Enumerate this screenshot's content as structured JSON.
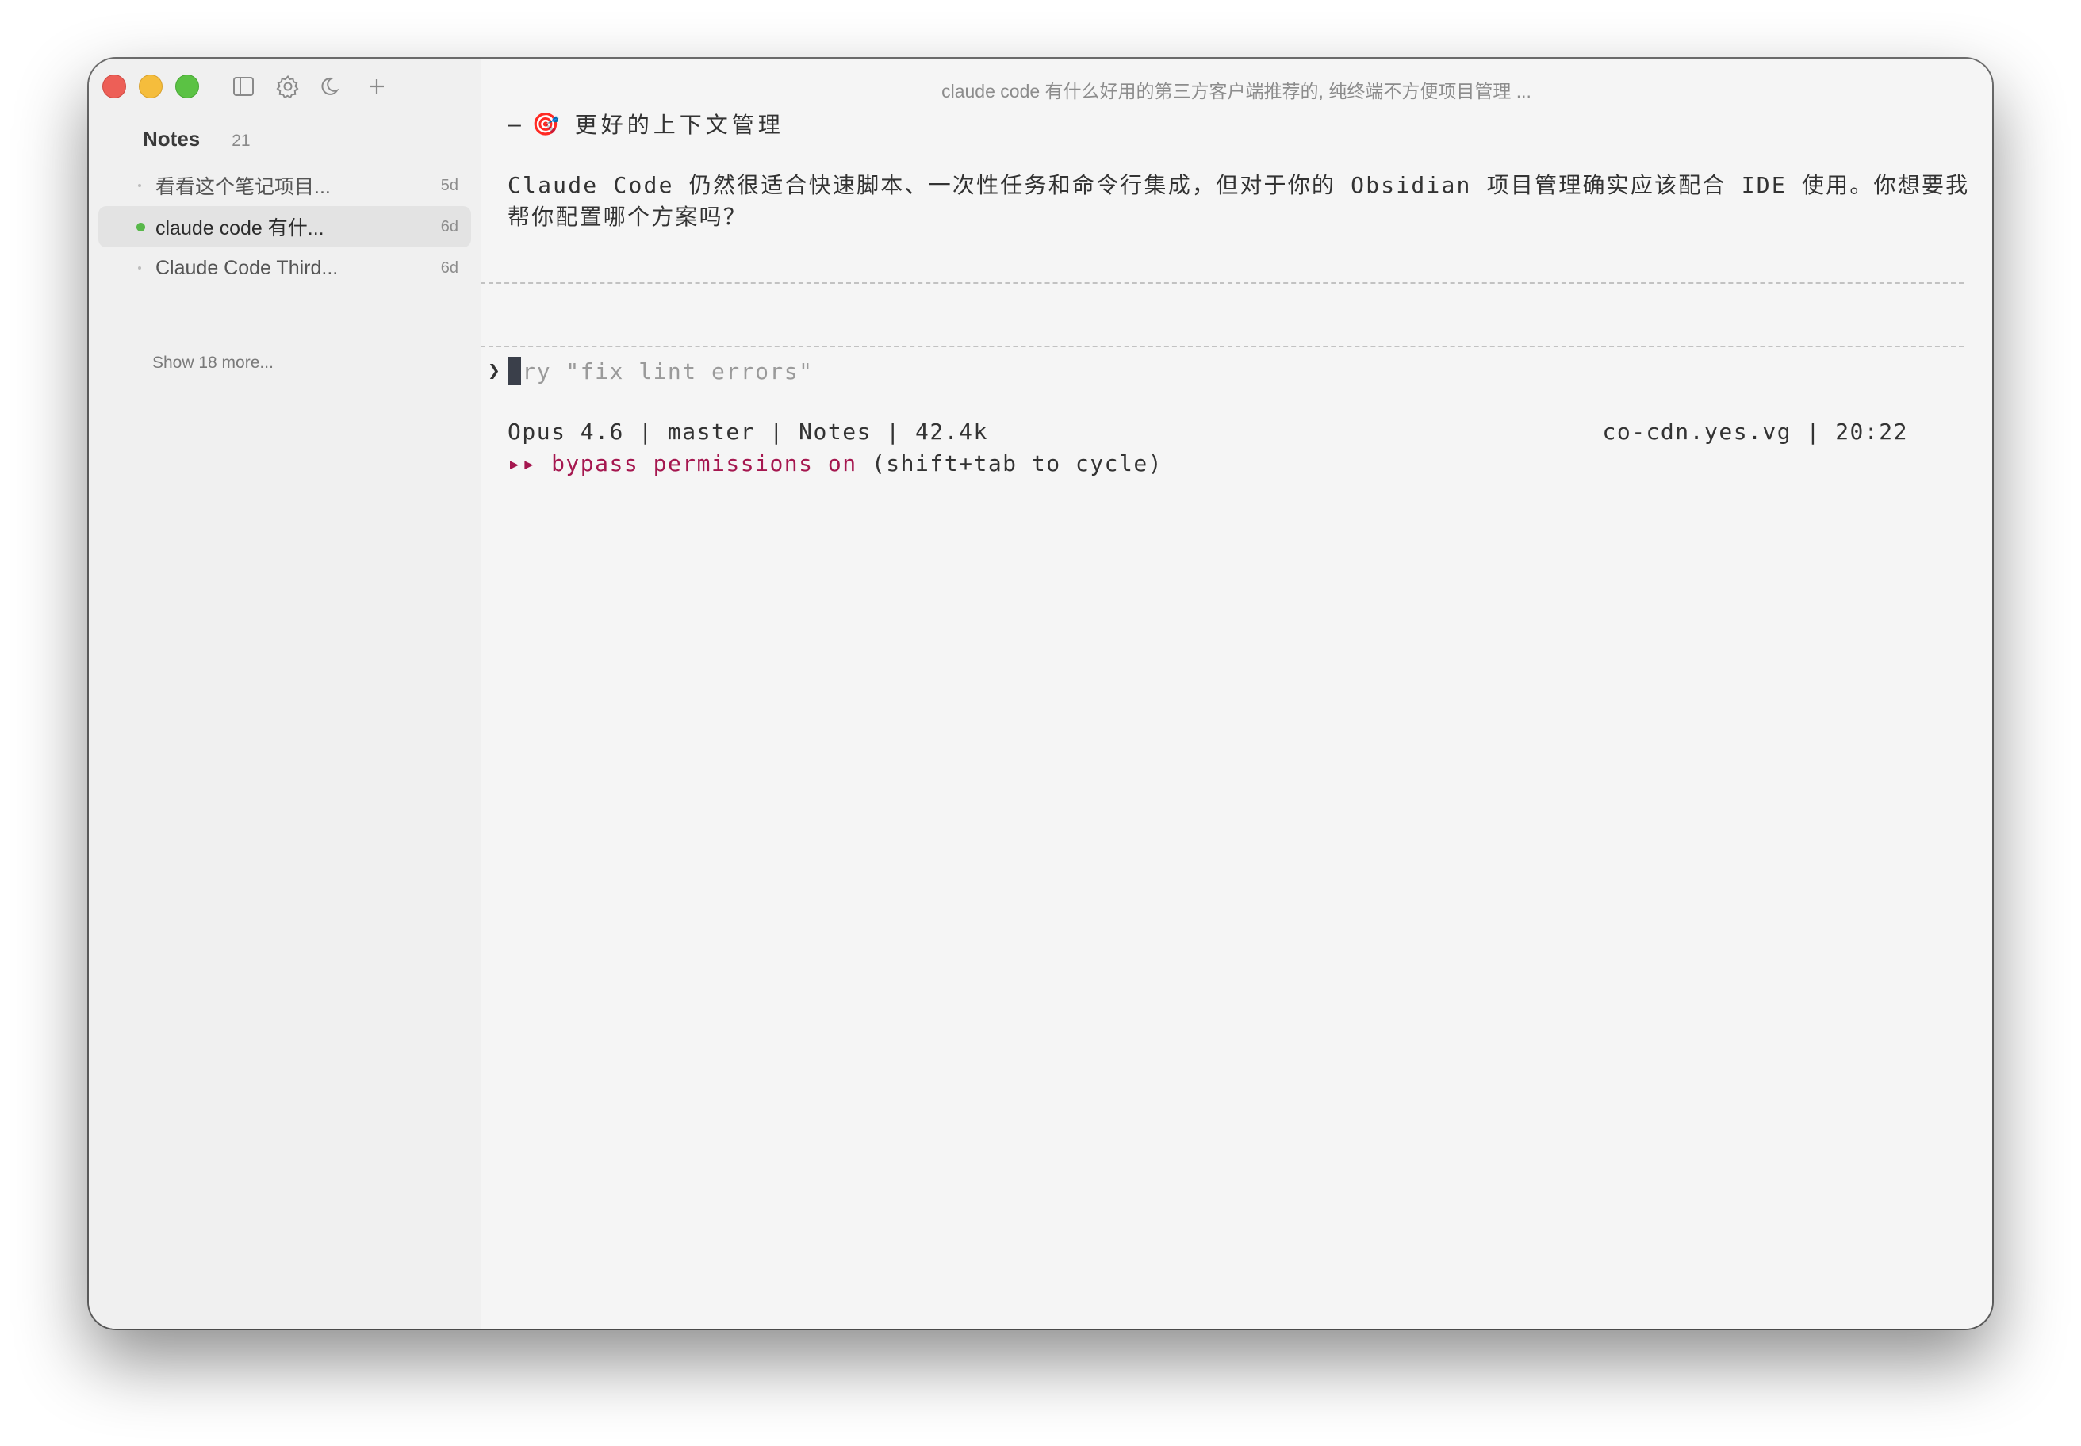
{
  "window": {
    "title": "claude code 有什么好用的第三方客户端推荐的, 纯终端不方便项目管理 ..."
  },
  "sidebar": {
    "notes_label": "Notes",
    "notes_count": "21",
    "items": [
      {
        "title": "看看这个笔记项目...",
        "age": "5d",
        "active": false
      },
      {
        "title": "claude code 有什...",
        "age": "6d",
        "active": true
      },
      {
        "title": "Claude Code Third...",
        "age": "6d",
        "active": false
      }
    ],
    "show_more": "Show 18 more...",
    "active_dot_color": "#58b84a"
  },
  "terminal": {
    "heading_dash": "–",
    "heading_icon": "🎯",
    "heading_text": "更好的上下文管理",
    "paragraph": "Claude Code 仍然很适合快速脚本、一次性任务和命令行集成，但对于你的 Obsidian 项目管理确实应该配合 IDE 使用。你想要我帮你配置哪个方案吗？",
    "prompt_symbol": "❯",
    "prompt_placeholder": "Try \"fix lint errors\"",
    "status_left": "Opus 4.6 | master | Notes | 42.4k",
    "status_right": "co-cdn.yes.vg | 20:22",
    "mode_arrows": "▸▸",
    "mode_label": "bypass permissions on",
    "mode_hint": "(shift+tab to cycle)",
    "accent_color": "#a5174f"
  }
}
